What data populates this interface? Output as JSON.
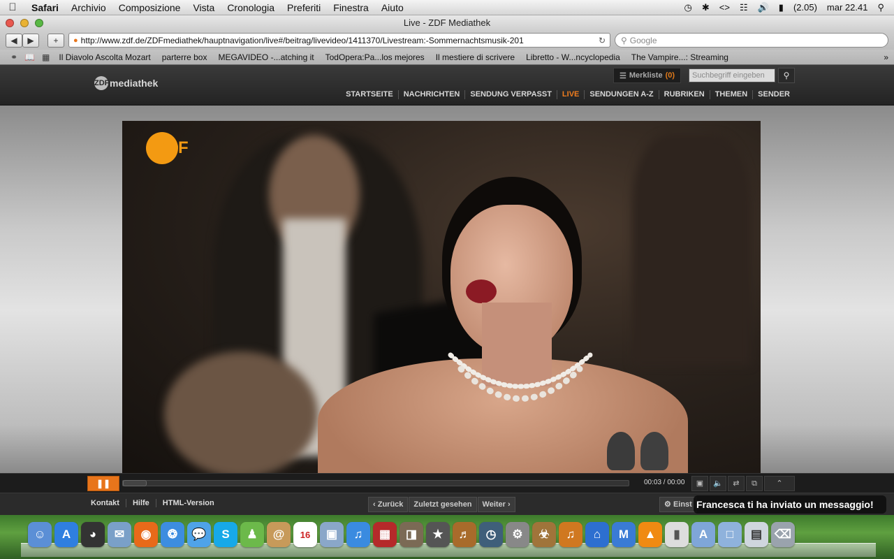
{
  "menubar": {
    "app": "Safari",
    "items": [
      "Archivio",
      "Composizione",
      "Vista",
      "Cronologia",
      "Preferiti",
      "Finestra",
      "Aiuto"
    ],
    "battery": "(2.05)",
    "clock": "mar 22.41"
  },
  "window": {
    "title": "Live - ZDF Mediathek"
  },
  "toolbar": {
    "url": "http://www.zdf.de/ZDFmediathek/hauptnavigation/live#/beitrag/livevideo/1411370/Livestream:-Sommernachtsmusik-201",
    "search_placeholder": "Google"
  },
  "bookmarks": [
    "Il Diavolo Ascolta Mozart",
    "parterre box",
    "MEGAVIDEO -...atching it",
    "TodOpera:Pa...los mejores",
    "Il mestiere di scrivere",
    "Libretto - W...ncyclopedia",
    "The Vampire...: Streaming"
  ],
  "site": {
    "logo_letters": "ZDF",
    "logo_word": "mediathek",
    "merkliste_label": "Merkliste",
    "merkliste_count": "(0)",
    "search_placeholder": "Suchbegriff eingeben",
    "nav": [
      "STARTSEITE",
      "NACHRICHTEN",
      "SENDUNG VERPASST",
      "LIVE",
      "SENDUNGEN A-Z",
      "RUBRIKEN",
      "THEMEN",
      "SENDER"
    ],
    "nav_active": "LIVE"
  },
  "player": {
    "watermark": "ZDF",
    "time": "00:03 / 00:00"
  },
  "footer": {
    "links": [
      "Kontakt",
      "Hilfe",
      "HTML-Version"
    ],
    "pager": [
      "‹ Zurück",
      "Zuletzt gesehen",
      "Weiter ›"
    ],
    "settings": "Einst"
  },
  "notification": "Francesca ti ha inviato un messaggio!",
  "calendar_day": "16",
  "colors": {
    "accent": "#e8751b",
    "nav_active": "#f07d1e",
    "dock_bg": "#4f8f36"
  }
}
